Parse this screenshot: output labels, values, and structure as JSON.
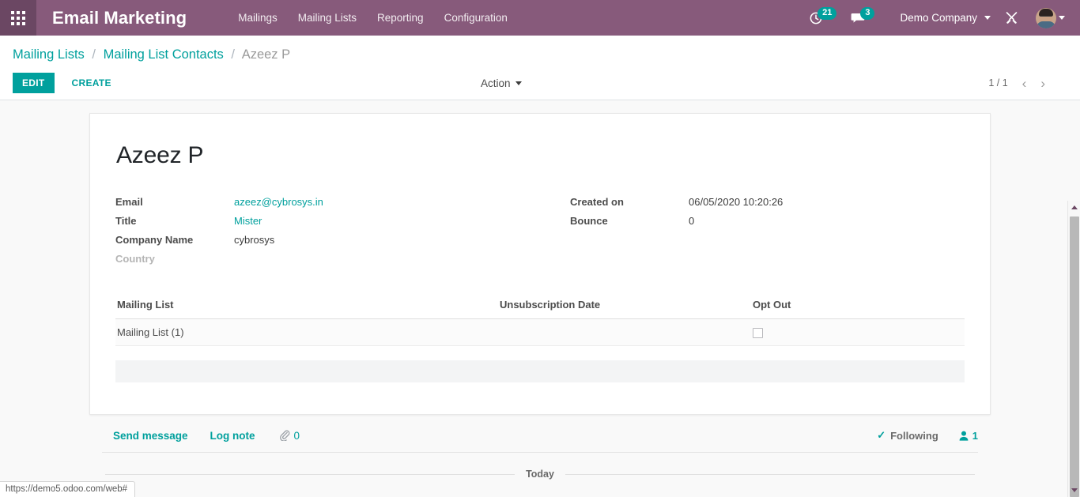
{
  "navbar": {
    "apps_icon": "apps-grid-icon",
    "brand": "Email Marketing",
    "menu": [
      {
        "label": "Mailings"
      },
      {
        "label": "Mailing Lists"
      },
      {
        "label": "Reporting"
      },
      {
        "label": "Configuration"
      }
    ],
    "activities": {
      "icon": "clock-icon",
      "count": "21"
    },
    "messages": {
      "icon": "chat-bubble-icon",
      "count": "3"
    },
    "company": "Demo Company",
    "debug_icon": "wrench-screwdriver-icon",
    "avatar_icon": "user-avatar"
  },
  "control_panel": {
    "breadcrumb": [
      {
        "label": "Mailing Lists",
        "current": false
      },
      {
        "label": "Mailing List Contacts",
        "current": false
      },
      {
        "label": "Azeez P",
        "current": true
      }
    ],
    "separator": "/",
    "edit_label": "EDIT",
    "create_label": "CREATE",
    "action_label": "Action",
    "pager": {
      "value": "1 / 1",
      "prev_icon": "chevron-left-icon",
      "next_icon": "chevron-right-icon"
    }
  },
  "record": {
    "title": "Azeez P",
    "fields_left": [
      {
        "label": "Email",
        "value": "azeez@cybrosys.in",
        "link": true,
        "muted": false
      },
      {
        "label": "Title",
        "value": "Mister",
        "link": true,
        "muted": false
      },
      {
        "label": "Company Name",
        "value": "cybrosys",
        "link": false,
        "muted": false
      },
      {
        "label": "Country",
        "value": "",
        "link": false,
        "muted": true
      }
    ],
    "fields_right": [
      {
        "label": "Created on",
        "value": "06/05/2020 10:20:26",
        "link": false,
        "muted": false
      },
      {
        "label": "Bounce",
        "value": "0",
        "link": false,
        "muted": false
      }
    ],
    "table": {
      "headers": [
        "Mailing List",
        "Unsubscription Date",
        "Opt Out"
      ],
      "rows": [
        {
          "mailing_list": "Mailing List (1)",
          "unsubscription_date": "",
          "opt_out": false
        }
      ]
    }
  },
  "chatter": {
    "send_message": "Send message",
    "log_note": "Log note",
    "attachment_icon": "paperclip-icon",
    "attachment_count": "0",
    "following_icon": "check-icon",
    "following_label": "Following",
    "followers_icon": "user-icon",
    "followers_count": "1",
    "today_label": "Today"
  },
  "statusbar": {
    "url": "https://demo5.odoo.com/web#"
  },
  "colors": {
    "brand_purple": "#875A7B",
    "apps_purple": "#6B4763",
    "accent_teal": "#00A09D",
    "muted_gray": "#9A9A9A"
  }
}
